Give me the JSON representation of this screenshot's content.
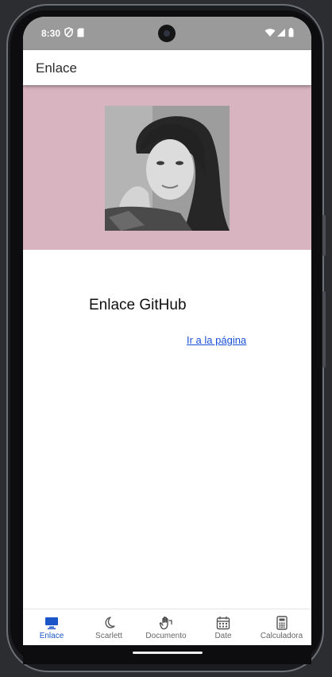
{
  "status_bar": {
    "time": "8:30"
  },
  "app_bar": {
    "title": "Enlace"
  },
  "profile": {
    "section_title": "Enlace GitHub",
    "link_label": "Ir a la página"
  },
  "bottom_nav": {
    "items": [
      {
        "label": "Enlace",
        "icon": "desktop-icon",
        "active": true
      },
      {
        "label": "Scarlett",
        "icon": "moon-icon",
        "active": false
      },
      {
        "label": "Documento",
        "icon": "hand-icon",
        "active": false
      },
      {
        "label": "Date",
        "icon": "calendar-icon",
        "active": false
      },
      {
        "label": "Calculadora",
        "icon": "calculator-icon",
        "active": false
      }
    ]
  },
  "colors": {
    "hero_background": "#d8b4c0",
    "accent": "#1a56c8",
    "link": "#1a4fd6"
  }
}
